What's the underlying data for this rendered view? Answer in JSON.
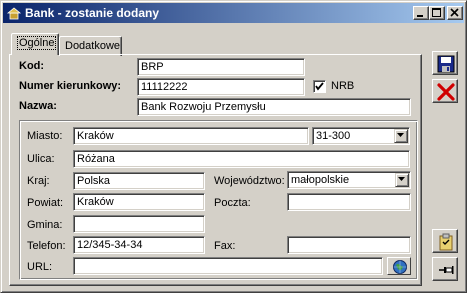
{
  "window": {
    "title": "Bank - zostanie dodany"
  },
  "tabs": [
    {
      "label": "Ogólne"
    },
    {
      "label": "Dodatkowe"
    }
  ],
  "form": {
    "kod": {
      "label": "Kod:",
      "value": "BRP"
    },
    "numer": {
      "label": "Numer kierunkowy:",
      "value": "11112222"
    },
    "nrb": {
      "label": "NRB",
      "checked": true
    },
    "nazwa": {
      "label": "Nazwa:",
      "value": "Bank Rozwoju Przemysłu"
    }
  },
  "address": {
    "miasto": {
      "label": "Miasto:",
      "value": "Kraków"
    },
    "kod_pocztowy": {
      "value": "31-300"
    },
    "ulica": {
      "label": "Ulica:",
      "value": "Różana"
    },
    "kraj": {
      "label": "Kraj:",
      "value": "Polska"
    },
    "wojewodztwo": {
      "label": "Województwo:",
      "value": "małopolskie"
    },
    "powiat": {
      "label": "Powiat:",
      "value": "Kraków"
    },
    "poczta": {
      "label": "Poczta:",
      "value": ""
    },
    "gmina": {
      "label": "Gmina:",
      "value": ""
    },
    "telefon": {
      "label": "Telefon:",
      "value": "12/345-34-34"
    },
    "fax": {
      "label": "Fax:",
      "value": ""
    },
    "url": {
      "label": "URL:",
      "value": ""
    }
  },
  "icons": {
    "save": "floppy-disk-icon",
    "cancel": "red-x-icon",
    "attachment": "clipboard-icon",
    "pin": "pushpin-icon",
    "url": "globe-icon"
  }
}
